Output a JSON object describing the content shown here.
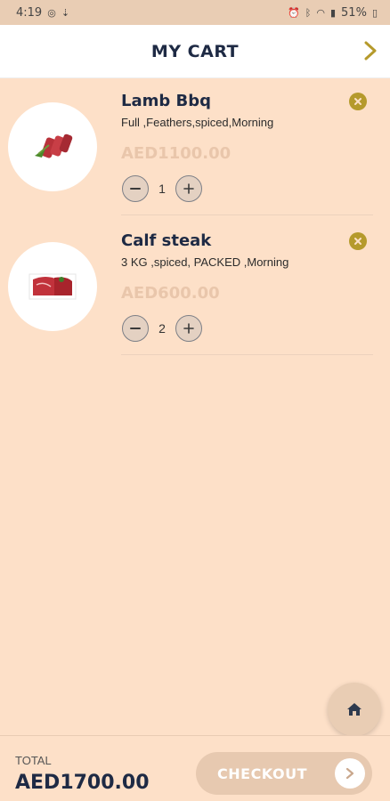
{
  "status_bar": {
    "time": "4:19",
    "battery": "51%"
  },
  "header": {
    "title": "MY CART"
  },
  "cart": {
    "items": [
      {
        "name": "Lamb Bbq",
        "options": "Full  ,Feathers,spiced,Morning",
        "price": "AED1100.00",
        "quantity": "1"
      },
      {
        "name": "Calf steak",
        "options": "3 KG ,spiced,  PACKED ,Morning",
        "price": "AED600.00",
        "quantity": "2"
      }
    ]
  },
  "footer": {
    "total_label": "TOTAL",
    "total_value": "AED1700.00",
    "checkout_label": "CHECKOUT"
  },
  "colors": {
    "accent": "#b59a2c",
    "background": "#fde0c8",
    "text": "#1e2a44",
    "price": "#e9c6ab"
  }
}
